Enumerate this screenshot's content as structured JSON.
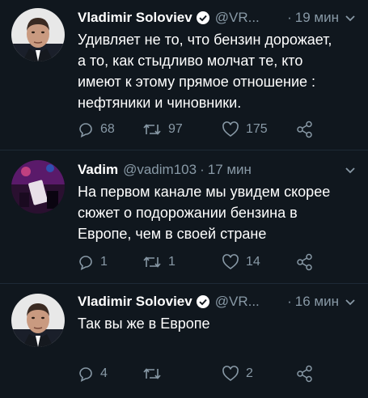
{
  "tweets": [
    {
      "author": "Vladimir Soloviev",
      "handle": "@VR...",
      "separator": "·",
      "time": "19 мин",
      "verified": true,
      "lines": [
        "Удивляет не то, что бензин дорожает,",
        "а то, как стыдливо молчат те, кто",
        "имеют к этому прямое отношение :",
        "нефтяники и чиновники."
      ],
      "replies": "68",
      "retweets": "97",
      "likes": "175"
    },
    {
      "author": "Vadim",
      "handle": "@vadim103",
      "separator": "·",
      "time": "17 мин",
      "verified": false,
      "lines": [
        "На первом канале мы увидем скорее",
        "сюжет о подорожании бензина в",
        "Европе, чем в своей стране"
      ],
      "replies": "1",
      "retweets": "1",
      "likes": "14"
    },
    {
      "author": "Vladimir Soloviev",
      "handle": "@VR...",
      "separator": "·",
      "time": "16 мин",
      "verified": true,
      "lines": [
        "Так вы же в Европе"
      ],
      "replies": "4",
      "retweets": "",
      "likes": "2"
    }
  ],
  "colors": {
    "background": "#10171e",
    "secondary_text": "#8899a6",
    "verified_badge": "#ffffff"
  },
  "icons": [
    "reply-icon",
    "retweet-icon",
    "like-icon",
    "share-icon",
    "verified-icon",
    "chevron-down-icon"
  ]
}
